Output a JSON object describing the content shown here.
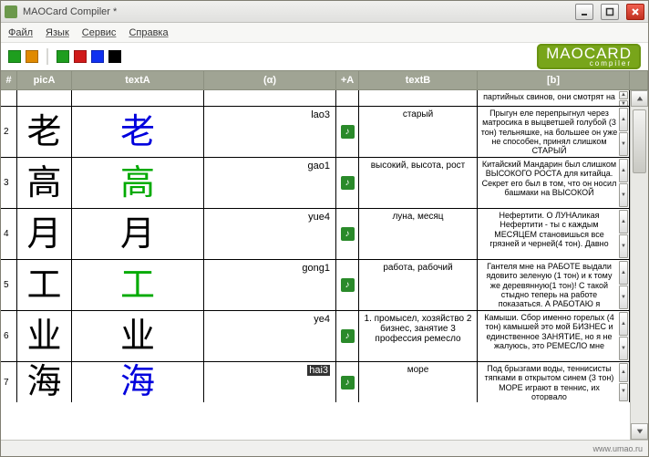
{
  "window": {
    "title": "MAOCard Compiler *"
  },
  "menu": {
    "file": "Файл",
    "lang": "Язык",
    "service": "Сервис",
    "help": "Справка"
  },
  "toolbar": {
    "palette": [
      "#1e9e1e",
      "#e08a00",
      "#ffffff",
      "#1e9e1e",
      "#d01a1a",
      "#1030f0",
      "#000000"
    ]
  },
  "brand": {
    "title": "MAOCARD",
    "sub": "compiler"
  },
  "columns": {
    "num": "#",
    "picA": "picA",
    "textA": "textA",
    "alpha": "(α)",
    "plusA": "+A",
    "textB": "textB",
    "b": "[b]"
  },
  "rows": [
    {
      "num": "",
      "hanzi": "",
      "textA": "",
      "textA_color": "green",
      "alpha": "",
      "alpha_sel": false,
      "sound": false,
      "textB": "",
      "b": "партийных свинов, они смотрят на меня"
    },
    {
      "num": "2",
      "hanzi": "老",
      "textA": "老",
      "textA_color": "blue",
      "alpha": "lao3",
      "alpha_sel": false,
      "sound": true,
      "textB": "старый",
      "b": "Прыгун еле перепрыгнул через матросика в выцветшей голубой (3 тон) тельняшке, на большее он уже не способен, принял слишком СТАРЫЙ"
    },
    {
      "num": "3",
      "hanzi": "高",
      "textA": "高",
      "textA_color": "green",
      "alpha": "gao1",
      "alpha_sel": false,
      "sound": true,
      "textB": "высокий, высота, рост",
      "b": "Китайский Мандарин был слишком ВЫСОКОГО РОСТА для китайца. Секрет его был в том, что он носил башмаки на ВЫСОКОЙ"
    },
    {
      "num": "4",
      "hanzi": "月",
      "textA": "月",
      "textA_color": "black",
      "alpha": "yue4",
      "alpha_sel": false,
      "sound": true,
      "textB": "луна, месяц",
      "b": "Нефертити. О ЛУНАликая Нефертити - ты с каждым МЕСЯЦЕМ становишься все грязней и черней(4 тон). Давно"
    },
    {
      "num": "5",
      "hanzi": "工",
      "textA": "工",
      "textA_color": "green",
      "alpha": "gong1",
      "alpha_sel": false,
      "sound": true,
      "textB": "работа, рабочий",
      "b": "Гантеля мне на РАБОТЕ выдали ядовито зеленую (1 тон) и к тому же деревянную(1 тон)! С такой стыдно теперь на работе показаться. А РАБОТАЮ я"
    },
    {
      "num": "6",
      "hanzi": "业",
      "textA": "业",
      "textA_color": "black",
      "alpha": "ye4",
      "alpha_sel": false,
      "sound": true,
      "textB": "1. промысел, хозяйство 2 бизнес, занятие 3 профессия ремесло",
      "b": "Камыши. Сбор именно горелых (4 тон) камышей это мой БИЗНЕС и единственное ЗАНЯТИЕ, но я не жалуюсь, это РЕМЕСЛО мне"
    },
    {
      "num": "7",
      "hanzi": "海",
      "textA": "海",
      "textA_color": "blue",
      "alpha": "hai3",
      "alpha_sel": true,
      "sound": true,
      "textB": "море",
      "b": "Под брызгами воды, теннисисты тяпками в открытом синем (3 тон) МОРЕ играют в теннис, их оторвало"
    }
  ],
  "status": {
    "url": "www.umao.ru"
  }
}
